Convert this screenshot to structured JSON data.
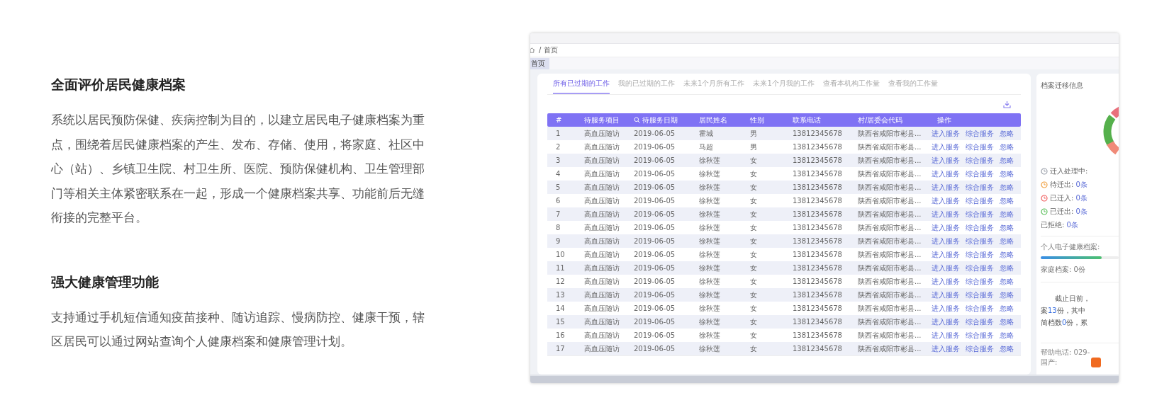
{
  "sections": [
    {
      "title": "全面评价居民健康档案",
      "body": "系统以居民预防保健、疾病控制为目的，以建立居民电子健康档案为重点，围绕着居民健康档案的产生、发布、存储、使用，将家庭、社区中心（站）、乡镇卫生院、村卫生所、医院、预防保健机构、卫生管理部门等相关主体紧密联系在一起，形成一个健康档案共享、功能前后无缝衔接的完整平台。"
    },
    {
      "title": "强大健康管理功能",
      "body": "支持通过手机短信通知疫苗接种、随访追踪、慢病防控、健康干预，辖区居民可以通过网站查询个人健康档案和健康管理计划。"
    }
  ],
  "screenshot": {
    "breadcrumb": "/ 首页",
    "page_tabs": [
      {
        "label": "首页",
        "selected": true
      }
    ],
    "work_tabs": [
      {
        "label": "所有已过期的工作",
        "selected": true
      },
      {
        "label": "我的已过期的工作",
        "selected": false
      },
      {
        "label": "未来1个月所有工作",
        "selected": false
      },
      {
        "label": "未来1个月我的工作",
        "selected": false
      },
      {
        "label": "查看本机构工作量",
        "selected": false
      },
      {
        "label": "查看我的工作量",
        "selected": false
      }
    ],
    "table": {
      "columns": [
        {
          "label": "#",
          "search": false
        },
        {
          "label": "待服务项目",
          "search": false
        },
        {
          "label": "待服务日期",
          "search": true
        },
        {
          "label": "居民姓名",
          "search": false
        },
        {
          "label": "性别",
          "search": false
        },
        {
          "label": "联系电话",
          "search": false
        },
        {
          "label": "村/居委会代码",
          "search": false
        },
        {
          "label": "操作",
          "search": false
        }
      ],
      "rows": [
        {
          "cells": [
            "1",
            "高血压随访",
            "2019-06-05",
            "霍城",
            "男",
            "13812345678",
            "陕西省咸阳市彬县..."
          ],
          "actions": [
            "进入服务",
            "综合服务",
            "忽略"
          ]
        },
        {
          "cells": [
            "2",
            "高血压随访",
            "2019-06-05",
            "马超",
            "男",
            "13812345678",
            "陕西省咸阳市彬县..."
          ],
          "actions": [
            "进入服务",
            "综合服务",
            "忽略"
          ]
        },
        {
          "cells": [
            "3",
            "高血压随访",
            "2019-06-05",
            "徐秋莲",
            "女",
            "13812345678",
            "陕西省咸阳市彬县..."
          ],
          "actions": [
            "进入服务",
            "综合服务",
            "忽略"
          ]
        },
        {
          "cells": [
            "4",
            "高血压随访",
            "2019-06-05",
            "徐秋莲",
            "女",
            "13812345678",
            "陕西省咸阳市彬县..."
          ],
          "actions": [
            "进入服务",
            "综合服务",
            "忽略"
          ]
        },
        {
          "cells": [
            "5",
            "高血压随访",
            "2019-06-05",
            "徐秋莲",
            "女",
            "13812345678",
            "陕西省咸阳市彬县..."
          ],
          "actions": [
            "进入服务",
            "综合服务",
            "忽略"
          ]
        },
        {
          "cells": [
            "6",
            "高血压随访",
            "2019-06-05",
            "徐秋莲",
            "女",
            "13812345678",
            "陕西省咸阳市彬县..."
          ],
          "actions": [
            "进入服务",
            "综合服务",
            "忽略"
          ]
        },
        {
          "cells": [
            "7",
            "高血压随访",
            "2019-06-05",
            "徐秋莲",
            "女",
            "13812345678",
            "陕西省咸阳市彬县..."
          ],
          "actions": [
            "进入服务",
            "综合服务",
            "忽略"
          ]
        },
        {
          "cells": [
            "8",
            "高血压随访",
            "2019-06-05",
            "徐秋莲",
            "女",
            "13812345678",
            "陕西省咸阳市彬县..."
          ],
          "actions": [
            "进入服务",
            "综合服务",
            "忽略"
          ]
        },
        {
          "cells": [
            "9",
            "高血压随访",
            "2019-06-05",
            "徐秋莲",
            "女",
            "13812345678",
            "陕西省咸阳市彬县..."
          ],
          "actions": [
            "进入服务",
            "综合服务",
            "忽略"
          ]
        },
        {
          "cells": [
            "10",
            "高血压随访",
            "2019-06-05",
            "徐秋莲",
            "女",
            "13812345678",
            "陕西省咸阳市彬县..."
          ],
          "actions": [
            "进入服务",
            "综合服务",
            "忽略"
          ]
        },
        {
          "cells": [
            "11",
            "高血压随访",
            "2019-06-05",
            "徐秋莲",
            "女",
            "13812345678",
            "陕西省咸阳市彬县..."
          ],
          "actions": [
            "进入服务",
            "综合服务",
            "忽略"
          ]
        },
        {
          "cells": [
            "12",
            "高血压随访",
            "2019-06-05",
            "徐秋莲",
            "女",
            "13812345678",
            "陕西省咸阳市彬县..."
          ],
          "actions": [
            "进入服务",
            "综合服务",
            "忽略"
          ]
        },
        {
          "cells": [
            "13",
            "高血压随访",
            "2019-06-05",
            "徐秋莲",
            "女",
            "13812345678",
            "陕西省咸阳市彬县..."
          ],
          "actions": [
            "进入服务",
            "综合服务",
            "忽略"
          ]
        },
        {
          "cells": [
            "14",
            "高血压随访",
            "2019-06-05",
            "徐秋莲",
            "女",
            "13812345678",
            "陕西省咸阳市彬县..."
          ],
          "actions": [
            "进入服务",
            "综合服务",
            "忽略"
          ]
        },
        {
          "cells": [
            "15",
            "高血压随访",
            "2019-06-05",
            "徐秋莲",
            "女",
            "13812345678",
            "陕西省咸阳市彬县..."
          ],
          "actions": [
            "进入服务",
            "综合服务",
            "忽略"
          ]
        },
        {
          "cells": [
            "16",
            "高血压随访",
            "2019-06-05",
            "徐秋莲",
            "女",
            "13812345678",
            "陕西省咸阳市彬县..."
          ],
          "actions": [
            "进入服务",
            "综合服务",
            "忽略"
          ]
        },
        {
          "cells": [
            "17",
            "高血压随访",
            "2019-06-05",
            "徐秋莲",
            "女",
            "13812345678",
            "陕西省咸阳市彬县..."
          ],
          "actions": [
            "进入服务",
            "综合服务",
            "忽略"
          ]
        }
      ]
    },
    "migration_panel": {
      "title": "档案迁移信息",
      "stats": [
        {
          "kind": "processing",
          "label": "迁入处理中:"
        },
        {
          "kind": "pending",
          "label": "待迁出:",
          "value": "0条"
        },
        {
          "kind": "in",
          "label": "已迁入:",
          "value": "0条"
        },
        {
          "kind": "out",
          "label": "已迁出:",
          "value": "0条"
        },
        {
          "kind": "rejected",
          "label": "已拒绝:",
          "value": "0条"
        }
      ],
      "record_progress": {
        "label": "个人电子健康档案:",
        "level": 0.78
      },
      "family": "家庭档案: 0份",
      "summary": [
        [
          {
            "kind": "text",
            "text": "截止日前，"
          }
        ],
        [
          {
            "kind": "text",
            "text": "案"
          },
          {
            "kind": "number",
            "text": "13"
          },
          {
            "kind": "text",
            "text": "份，其中"
          }
        ],
        [
          {
            "kind": "text",
            "text": "简档数"
          },
          {
            "kind": "number",
            "text": "0"
          },
          {
            "kind": "text",
            "text": "份，累"
          }
        ]
      ],
      "footer": [
        "帮助电话: 029-",
        "国产:"
      ]
    }
  }
}
